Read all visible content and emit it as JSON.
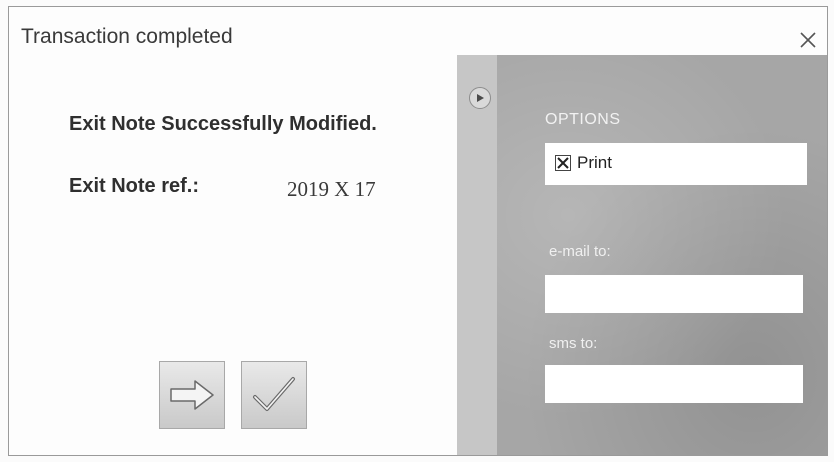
{
  "dialog": {
    "title": "Transaction completed",
    "close_icon": "close-icon"
  },
  "message": {
    "success": "Exit Note Successfully Modified.",
    "ref_label": "Exit Note ref.:",
    "ref_value": "2019 X 17"
  },
  "actions": {
    "next_icon": "arrow-right-icon",
    "confirm_icon": "checkmark-icon"
  },
  "options": {
    "heading": "OPTIONS",
    "print": {
      "label": "Print",
      "checked": true
    },
    "email_label": "e-mail to:",
    "email_value": "",
    "sms_label": "sms to:",
    "sms_value": "",
    "toggle_icon": "expand-arrow-icon"
  },
  "colors": {
    "panel_bg": "#a6a6a6",
    "dialog_bg": "#fdfdfd"
  }
}
